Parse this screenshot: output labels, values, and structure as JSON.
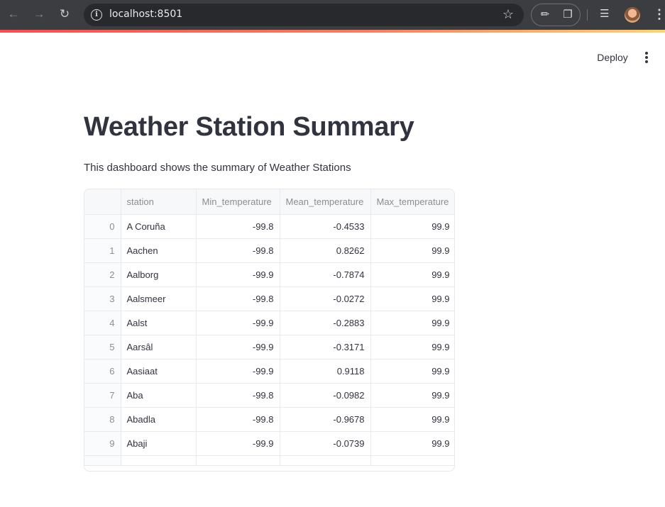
{
  "browser": {
    "url": "localhost:8501"
  },
  "header": {
    "deploy_label": "Deploy"
  },
  "main": {
    "title": "Weather Station Summary",
    "subtitle": "This dashboard shows the summary of Weather Stations"
  },
  "table": {
    "columns": [
      "",
      "station",
      "Min_temperature",
      "Mean_temperature",
      "Max_temperature"
    ],
    "rows": [
      [
        "0",
        "A Coruña",
        "-99.8",
        "-0.4533",
        "99.9"
      ],
      [
        "1",
        "Aachen",
        "-99.8",
        "0.8262",
        "99.9"
      ],
      [
        "2",
        "Aalborg",
        "-99.9",
        "-0.7874",
        "99.9"
      ],
      [
        "3",
        "Aalsmeer",
        "-99.8",
        "-0.0272",
        "99.9"
      ],
      [
        "4",
        "Aalst",
        "-99.9",
        "-0.2883",
        "99.9"
      ],
      [
        "5",
        "Aarsâl",
        "-99.9",
        "-0.3171",
        "99.9"
      ],
      [
        "6",
        "Aasiaat",
        "-99.9",
        "0.9118",
        "99.9"
      ],
      [
        "7",
        "Aba",
        "-99.8",
        "-0.0982",
        "99.9"
      ],
      [
        "8",
        "Abadla",
        "-99.8",
        "-0.9678",
        "99.9"
      ],
      [
        "9",
        "Abaji",
        "-99.9",
        "-0.0739",
        "99.9"
      ]
    ]
  }
}
